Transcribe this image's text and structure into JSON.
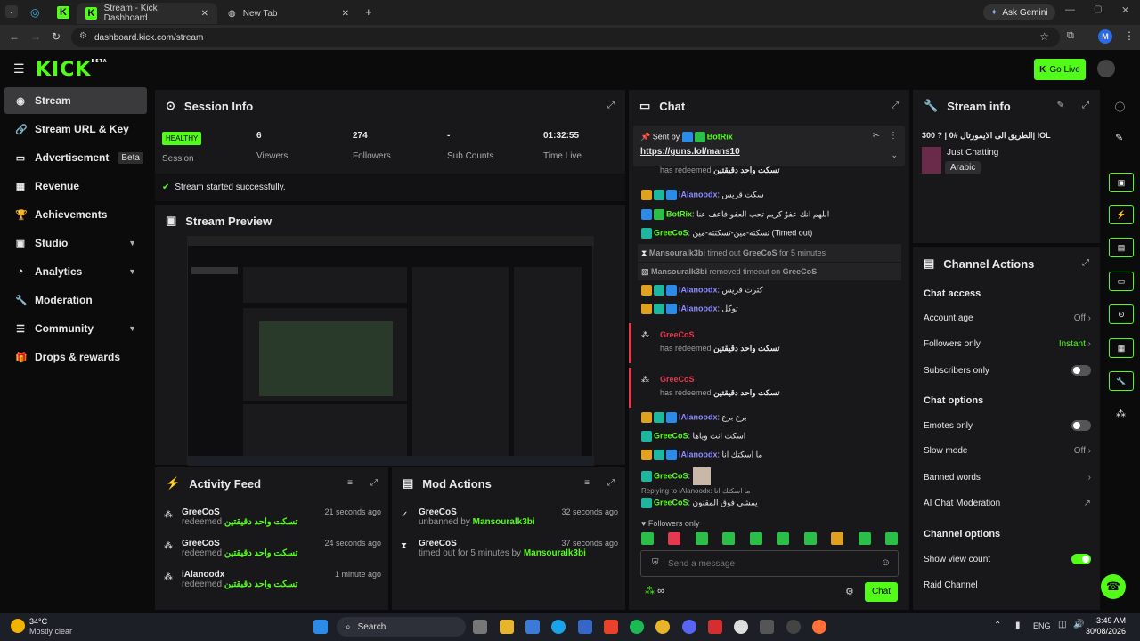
{
  "browser": {
    "tab1_title": "Stream - Kick Dashboard",
    "tab2_title": "New Tab",
    "ask_gemini": "Ask Gemini",
    "url": "dashboard.kick.com/stream",
    "profile_initial": "M"
  },
  "header": {
    "logo": "KICK",
    "beta": "BETA",
    "go_live": "Go Live"
  },
  "sidebar": {
    "items": [
      {
        "label": "Stream"
      },
      {
        "label": "Stream URL & Key"
      },
      {
        "label": "Advertisement",
        "badge": "Beta"
      },
      {
        "label": "Revenue"
      },
      {
        "label": "Achievements"
      },
      {
        "label": "Studio"
      },
      {
        "label": "Analytics"
      },
      {
        "label": "Moderation"
      },
      {
        "label": "Community"
      },
      {
        "label": "Drops & rewards"
      }
    ]
  },
  "session": {
    "title": "Session Info",
    "health": "HEALTHY",
    "health_label": "Session",
    "viewers": "6",
    "viewers_label": "Viewers",
    "followers": "274",
    "followers_label": "Followers",
    "subs": "-",
    "subs_label": "Sub Counts",
    "time": "01:32:55",
    "time_label": "Time Live",
    "status_msg": "Stream started successfully."
  },
  "preview": {
    "title": "Stream Preview"
  },
  "activity": {
    "title": "Activity Feed",
    "items": [
      {
        "name": "GreeCoS",
        "action": "redeemed",
        "reward": "تسكت واحد دقيقتين",
        "time": "21 seconds ago"
      },
      {
        "name": "GreeCoS",
        "action": "redeemed",
        "reward": "تسكت واحد دقيقتين",
        "time": "24 seconds ago"
      },
      {
        "name": "iAlanoodx",
        "action": "redeemed",
        "reward": "تسكت واحد دقيقتين",
        "time": "1 minute ago"
      }
    ]
  },
  "mod": {
    "title": "Mod Actions",
    "items": [
      {
        "name": "GreeCoS",
        "detail": "unbanned by",
        "by": "Mansouralk3bi",
        "time": "32 seconds ago"
      },
      {
        "name": "GreeCoS",
        "detail": "timed out for 5 minutes by",
        "by": "Mansouralk3bi",
        "time": "37 seconds ago"
      }
    ]
  },
  "chat": {
    "title": "Chat",
    "pinned_by": "Sent by",
    "pinned_user": "BotRix",
    "pinned_link": "https://guns.lol/mans10",
    "redeem_text": "has redeemed",
    "redeem_reward": "تسكت واحد دقيقتين",
    "lines": [
      {
        "user": "iAlanoodx",
        "msg": "سكت قريس"
      },
      {
        "user": "BotRix",
        "msg": "اللهم انك عفوٌ كريم تحب العفو فاعف عنا"
      },
      {
        "user": "GreeCoS",
        "msg": "تسكته-مين-تسكتته-مين (Timed out)"
      },
      {
        "user": "Mansouralk3bi",
        "msg": "timed out",
        "target": "GreeCoS",
        "extra": "for 5 minutes"
      },
      {
        "user": "Mansouralk3bi",
        "msg": "removed timeout on",
        "target": "GreeCoS"
      },
      {
        "user": "iAlanoodx",
        "msg": "كثرت قريس"
      },
      {
        "user": "iAlanoodx",
        "msg": "توكل"
      },
      {
        "user": "GreeCoS",
        "msg": "has redeemed"
      },
      {
        "user": "GreeCoS",
        "msg": "has redeemed"
      },
      {
        "user": "iAlanoodx",
        "msg": "برع برع"
      },
      {
        "user": "GreeCoS",
        "msg": "اسكت انت وياها"
      },
      {
        "user": "iAlanoodx",
        "msg": "ما اسكتك انا"
      },
      {
        "user": "GreeCoS",
        "msg": ""
      },
      {
        "user": "GreeCoS",
        "msg": "يمشي فوق المقنون"
      }
    ],
    "replying": "Replying to iAlanoodx: ما اسكتك انا",
    "followers_only": "Followers only",
    "placeholder": "Send a message",
    "send": "Chat",
    "infinity": "∞"
  },
  "stream_info": {
    "title": "Stream info",
    "stream_title": "الطريق الى الايمورتال #0 | ? 300| IOL",
    "category": "Just Chatting",
    "language": "Arabic"
  },
  "channel_actions": {
    "title": "Channel Actions",
    "chat_access": "Chat access",
    "account_age": "Account age",
    "account_age_val": "Off",
    "followers_only": "Followers only",
    "followers_only_val": "Instant",
    "subscribers_only": "Subscribers only",
    "chat_options": "Chat options",
    "emotes_only": "Emotes only",
    "slow_mode": "Slow mode",
    "slow_mode_val": "Off",
    "banned_words": "Banned words",
    "ai_mod": "AI Chat Moderation",
    "channel_options": "Channel options",
    "show_view_count": "Show view count",
    "raid_channel": "Raid Channel"
  },
  "taskbar": {
    "temp": "34°C",
    "weather": "Mostly clear",
    "search": "Search",
    "lang": "ENG",
    "time": "3:49 AM",
    "date": "30/08/2026"
  },
  "colors": {
    "accent": "#53fc18",
    "panel": "#18181b",
    "bg": "#0b0b0c"
  }
}
